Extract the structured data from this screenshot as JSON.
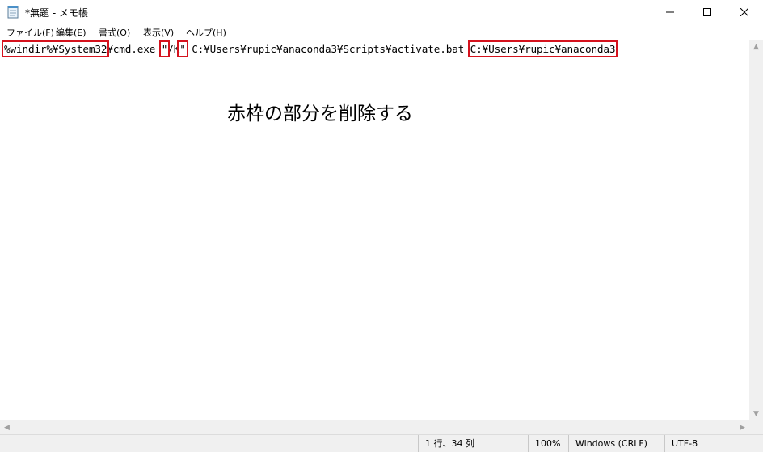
{
  "window": {
    "title": "*無題 - メモ帳",
    "controls": {
      "minimize": "minimize-icon",
      "maximize": "maximize-icon",
      "close": "close-icon"
    }
  },
  "menu": {
    "items": [
      "ファイル(F)",
      "編集(E)",
      "書式(O)",
      "表示(V)",
      "ヘルプ(H)"
    ]
  },
  "editor": {
    "segments": {
      "s1": "%windir%¥System32",
      "s2": "¥cmd.exe ",
      "s3": "\"",
      "s4": "/K",
      "s5": "\"",
      "s6": " C:¥Users¥rupic¥anaconda3¥Scripts¥activate.bat ",
      "s7": "C:¥Users¥rupic¥anaconda3"
    },
    "highlight_color": "#d5121d"
  },
  "annotation": {
    "text": "赤枠の部分を削除する"
  },
  "status": {
    "position": "1 行、34 列",
    "zoom": "100%",
    "line_ending": "Windows (CRLF)",
    "encoding": "UTF-8"
  }
}
